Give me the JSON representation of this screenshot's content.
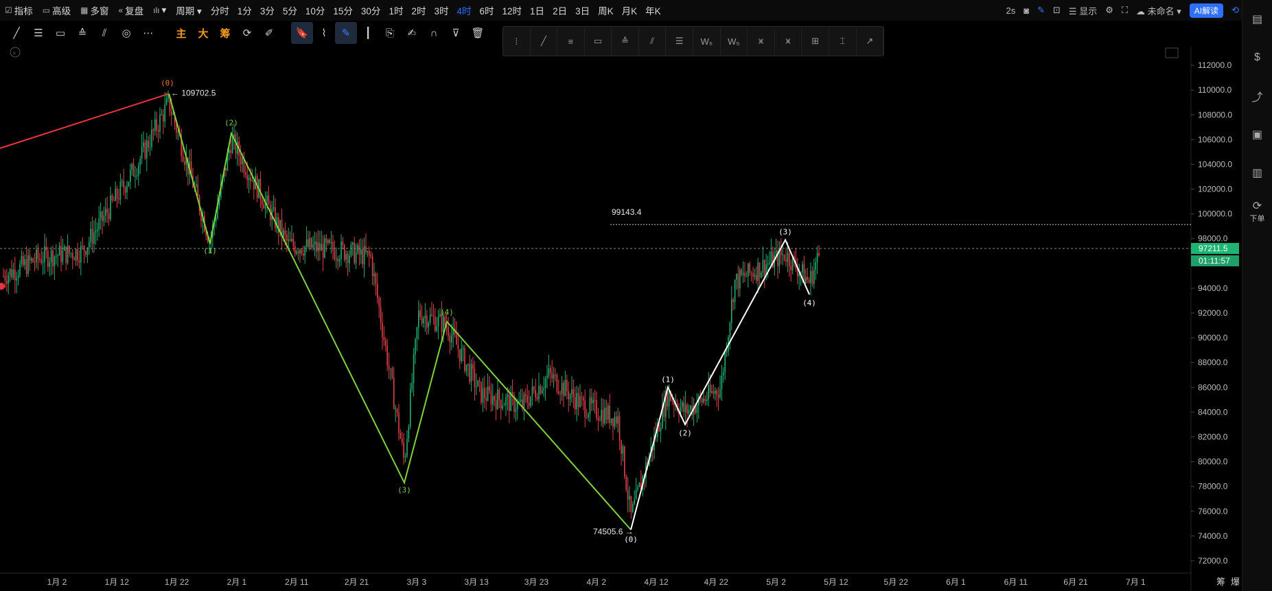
{
  "topbar": {
    "items": [
      {
        "icon": "indicator-icon",
        "glyph": "☑",
        "label": "指标"
      },
      {
        "icon": "advanced-icon",
        "glyph": "▭",
        "label": "高级"
      },
      {
        "icon": "multiwindow-icon",
        "glyph": "▦",
        "label": "多窗"
      },
      {
        "icon": "replay-icon",
        "glyph": "«",
        "label": "复盘"
      },
      {
        "icon": "chart-type-icon",
        "glyph": "ılı",
        "label": "▾"
      }
    ],
    "period_label": "周期 ▾",
    "periods": [
      "分时",
      "1分",
      "3分",
      "5分",
      "10分",
      "15分",
      "30分",
      "1时",
      "2时",
      "3时",
      "4时",
      "6时",
      "12时",
      "1日",
      "2日",
      "3日",
      "周K",
      "月K",
      "年K"
    ],
    "active_period": "4时",
    "right": {
      "interval": "2s",
      "display": "显示",
      "unnamed": "未命名 ▾",
      "ai": "AI解读"
    }
  },
  "toolbar2": {
    "tools": [
      {
        "name": "line-tool-icon",
        "glyph": "╱"
      },
      {
        "name": "horizontal-lines-icon",
        "glyph": "☰"
      },
      {
        "name": "rectangle-icon",
        "glyph": "▭"
      },
      {
        "name": "price-range-icon",
        "glyph": "≙"
      },
      {
        "name": "parallel-channel-icon",
        "glyph": "⫽"
      },
      {
        "name": "spiral-icon",
        "glyph": "◎"
      },
      {
        "name": "more-icon",
        "glyph": "⋯"
      }
    ],
    "labels": {
      "main": "主",
      "big": "大",
      "chips": "筹"
    },
    "tools_right": [
      {
        "name": "sync-icon",
        "glyph": "⟳"
      },
      {
        "name": "pen-icon",
        "glyph": "✐"
      },
      {
        "name": "bookmark-icon",
        "glyph": "🔖"
      },
      {
        "name": "ruler-icon",
        "glyph": "⌇"
      },
      {
        "name": "draw-icon",
        "glyph": "✎"
      },
      {
        "name": "candle-icon",
        "glyph": "┃"
      },
      {
        "name": "copy-icon",
        "glyph": "⎘"
      },
      {
        "name": "edit-icon",
        "glyph": "✍"
      },
      {
        "name": "magnet-icon",
        "glyph": "∩"
      },
      {
        "name": "filter-icon",
        "glyph": "⊽"
      },
      {
        "name": "trash-icon",
        "glyph": "🗑"
      }
    ]
  },
  "drawbar": [
    "⁞",
    "╱",
    "≡",
    "▭",
    "≙",
    "⫽",
    "☰",
    "W₅",
    "W₅",
    "⩙",
    "⩙",
    "⊞",
    "⌶",
    "↗"
  ],
  "right_sidebar": [
    {
      "name": "notes-icon",
      "glyph": "▤",
      "label": ""
    },
    {
      "name": "dollar-icon",
      "glyph": "$",
      "label": ""
    },
    {
      "name": "analysis-icon",
      "glyph": "⤴",
      "label": ""
    },
    {
      "name": "monitor-icon",
      "glyph": "▣",
      "label": ""
    },
    {
      "name": "etf-icon",
      "glyph": "▥",
      "label": ""
    },
    {
      "name": "order-icon",
      "glyph": "⟳",
      "label": "下单"
    }
  ],
  "chart_data": {
    "type": "candlestick",
    "y_axis_ticks": [
      "72000.0",
      "74000.0",
      "76000.0",
      "78000.0",
      "80000.0",
      "82000.0",
      "84000.0",
      "86000.0",
      "88000.0",
      "90000.0",
      "92000.0",
      "94000.0",
      "96000.0",
      "98000.0",
      "100000.0",
      "102000.0",
      "104000.0",
      "106000.0",
      "108000.0",
      "110000.0",
      "112000.0"
    ],
    "ylim": [
      71000,
      113500
    ],
    "x_axis_ticks": [
      "1月 2",
      "1月 12",
      "1月 22",
      "2月 1",
      "2月 11",
      "2月 21",
      "3月 3",
      "3月 13",
      "3月 23",
      "4月 2",
      "4月 12",
      "4月 22",
      "5月 2",
      "5月 12",
      "5月 22",
      "6月 1",
      "6月 11",
      "6月 21",
      "7月 1"
    ],
    "current_price": "97211.5",
    "countdown": "01:11:57",
    "high_label": "109702.5",
    "low_label": "74505.6",
    "level_label": "99143.4",
    "footer_labels": [
      "筹",
      "爆"
    ],
    "wave_green": {
      "labels": [
        "(0)",
        "(1)",
        "(2)",
        "(3)",
        "(4)"
      ],
      "points": [
        [
          246,
          109702
        ],
        [
          306,
          97600
        ],
        [
          337,
          106500
        ],
        [
          589,
          78300
        ],
        [
          651,
          91300
        ],
        [
          919,
          74505
        ]
      ]
    },
    "wave_white": {
      "labels": [
        "(0)",
        "(1)",
        "(2)",
        "(3)",
        "(4)"
      ],
      "points": [
        [
          919,
          74505
        ],
        [
          973,
          86000
        ],
        [
          998,
          83000
        ],
        [
          1144,
          97900
        ],
        [
          1179,
          93500
        ]
      ]
    },
    "red_line": [
      [
        0,
        105300
      ],
      [
        246,
        109702
      ]
    ]
  }
}
